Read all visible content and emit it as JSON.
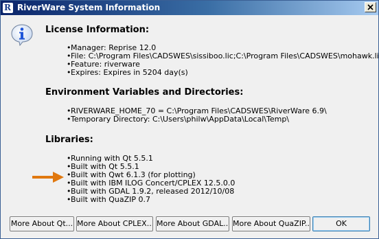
{
  "window": {
    "title": "RiverWare System Information",
    "app_icon_glyph": "R",
    "colors": {
      "arrow": "#e0780f",
      "title_start": "#0a246a",
      "info_icon": "#1f55d8"
    }
  },
  "sections": [
    {
      "title": "License Information:",
      "items": [
        "Manager: Reprise 12.0",
        "File: C:\\Program Files\\CADSWES\\sissiboo.lic;C:\\Program Files\\CADSWES\\mohawk.lic",
        "Feature: riverware",
        "Expires: Expires in 5204 day(s)"
      ]
    },
    {
      "title": "Environment Variables and Directories:",
      "items": [
        "RIVERWARE_HOME_70 = C:\\Program Files\\CADSWES\\RiverWare 6.9\\",
        "Temporary Directory: C:\\Users\\philw\\AppData\\Local\\Temp\\"
      ]
    },
    {
      "title": "Libraries:",
      "items": [
        "Running with Qt 5.5.1",
        "Built with Qt 5.5.1",
        "Built with Qwt 6.1.3 (for plotting)",
        "Built with IBM ILOG Concert/CPLEX 12.5.0.0",
        "Built with GDAL 1.9.2, released 2012/10/08",
        "Built with QuaZIP 0.7"
      ]
    }
  ],
  "buttons": {
    "more_qt": "More About Qt...",
    "more_cplex": "More About CPLEX...",
    "more_gdal": "More About GDAL...",
    "more_quazip": "More About QuaZIP...",
    "ok": "OK"
  }
}
